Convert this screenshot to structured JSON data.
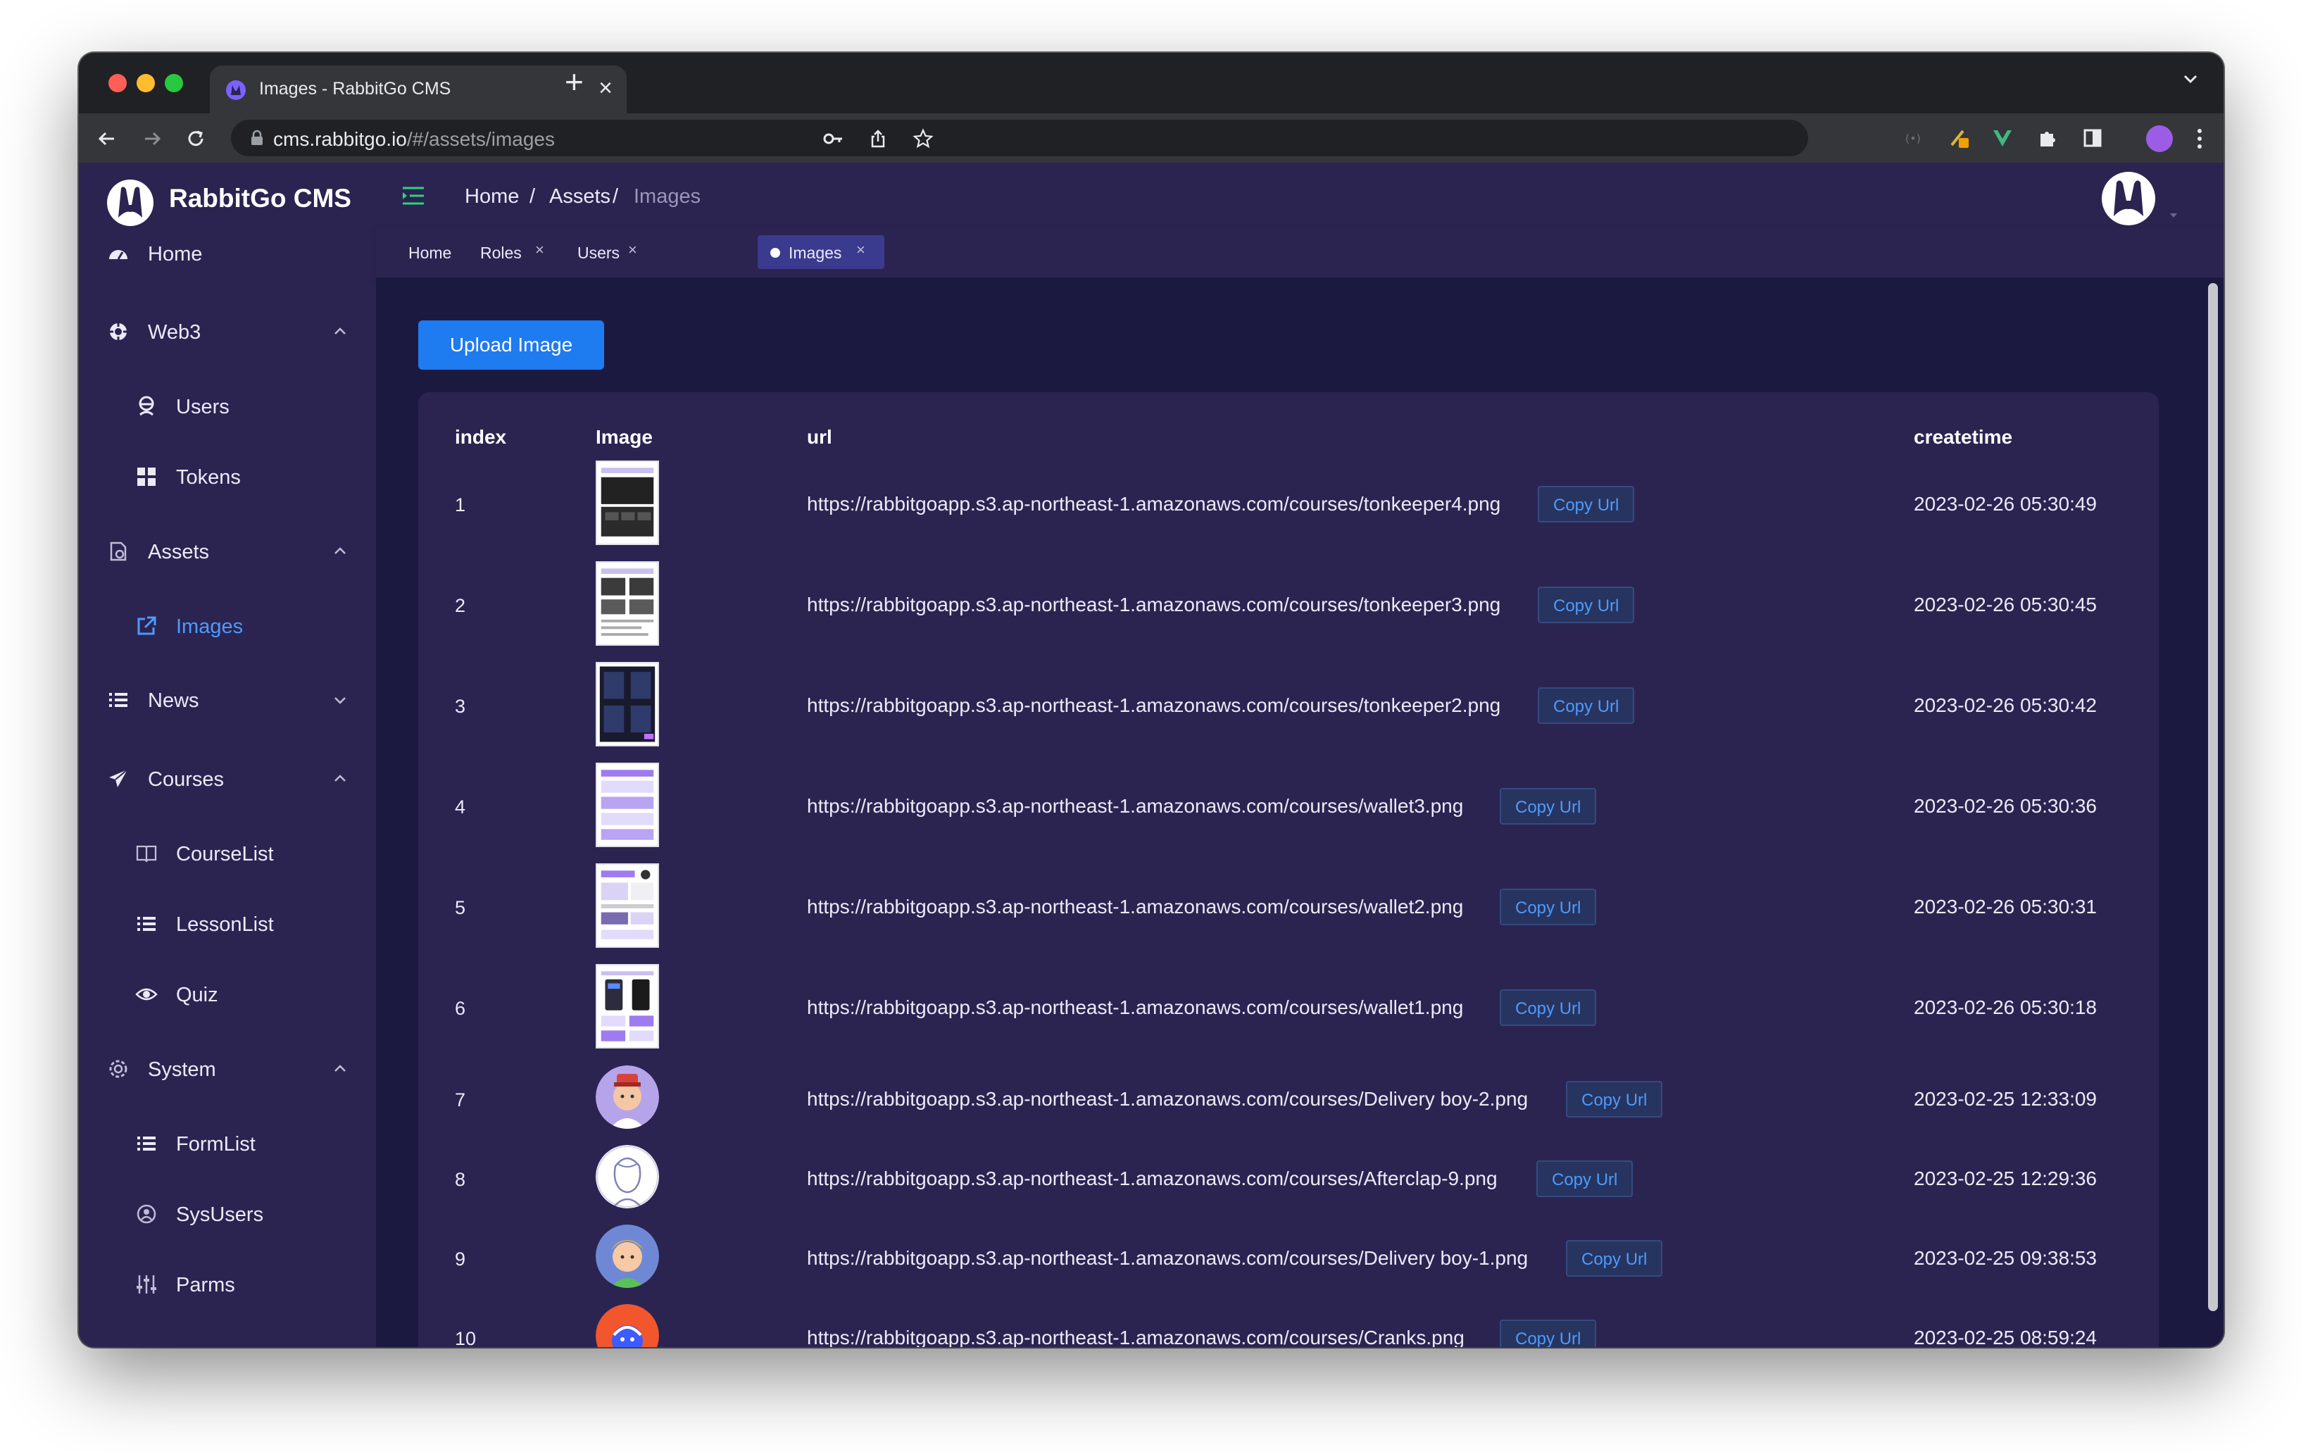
{
  "browser": {
    "tab_title": "Images - RabbitGo CMS",
    "url_host": "cms.rabbitgo.io",
    "url_path": "/#/assets/images"
  },
  "brand": {
    "name": "RabbitGo CMS"
  },
  "sidebar": {
    "items": [
      {
        "label": "Home",
        "icon": "dashboard-icon"
      },
      {
        "label": "Web3",
        "icon": "web3-icon"
      },
      {
        "label": "Users",
        "icon": "users-icon"
      },
      {
        "label": "Tokens",
        "icon": "grid-icon"
      },
      {
        "label": "Assets",
        "icon": "assets-icon"
      },
      {
        "label": "Images",
        "icon": "external-link-icon"
      },
      {
        "label": "News",
        "icon": "list-icon"
      },
      {
        "label": "Courses",
        "icon": "paper-plane-icon"
      },
      {
        "label": "CourseList",
        "icon": "book-icon"
      },
      {
        "label": "LessonList",
        "icon": "list-icon"
      },
      {
        "label": "Quiz",
        "icon": "eye-icon"
      },
      {
        "label": "System",
        "icon": "gear-icon"
      },
      {
        "label": "FormList",
        "icon": "list-icon"
      },
      {
        "label": "SysUsers",
        "icon": "user-circle-icon"
      },
      {
        "label": "Parms",
        "icon": "sliders-icon"
      }
    ]
  },
  "breadcrumb": {
    "home": "Home",
    "sep1": "/",
    "assets": "Assets",
    "sep2": "/",
    "current": "Images"
  },
  "tags": [
    {
      "label": "Home"
    },
    {
      "label": "Roles",
      "close": "×"
    },
    {
      "label": "Users",
      "close": "×"
    },
    {
      "label": "Images",
      "close": "×"
    }
  ],
  "upload_label": "Upload Image",
  "table": {
    "columns": {
      "index": "index",
      "image": "Image",
      "url": "url",
      "createtime": "createtime"
    },
    "copy_label": "Copy Url",
    "rows": [
      {
        "index": "1",
        "url": "https://rabbitgoapp.s3.ap-northeast-1.amazonaws.com/courses/tonkeeper4.png",
        "createtime": "2023-02-26 05:30:49"
      },
      {
        "index": "2",
        "url": "https://rabbitgoapp.s3.ap-northeast-1.amazonaws.com/courses/tonkeeper3.png",
        "createtime": "2023-02-26 05:30:45"
      },
      {
        "index": "3",
        "url": "https://rabbitgoapp.s3.ap-northeast-1.amazonaws.com/courses/tonkeeper2.png",
        "createtime": "2023-02-26 05:30:42"
      },
      {
        "index": "4",
        "url": "https://rabbitgoapp.s3.ap-northeast-1.amazonaws.com/courses/wallet3.png",
        "createtime": "2023-02-26 05:30:36"
      },
      {
        "index": "5",
        "url": "https://rabbitgoapp.s3.ap-northeast-1.amazonaws.com/courses/wallet2.png",
        "createtime": "2023-02-26 05:30:31"
      },
      {
        "index": "6",
        "url": "https://rabbitgoapp.s3.ap-northeast-1.amazonaws.com/courses/wallet1.png",
        "createtime": "2023-02-26 05:30:18"
      },
      {
        "index": "7",
        "url": "https://rabbitgoapp.s3.ap-northeast-1.amazonaws.com/courses/Delivery boy-2.png",
        "createtime": "2023-02-25 12:33:09"
      },
      {
        "index": "8",
        "url": "https://rabbitgoapp.s3.ap-northeast-1.amazonaws.com/courses/Afterclap-9.png",
        "createtime": "2023-02-25 12:29:36"
      },
      {
        "index": "9",
        "url": "https://rabbitgoapp.s3.ap-northeast-1.amazonaws.com/courses/Delivery boy-1.png",
        "createtime": "2023-02-25 09:38:53"
      },
      {
        "index": "10",
        "url": "https://rabbitgoapp.s3.ap-northeast-1.amazonaws.com/courses/Cranks.png",
        "createtime": "2023-02-25 08:59:24"
      }
    ]
  },
  "colors": {
    "sidebar_bg": "#2b2451",
    "content_bg": "#1c1940",
    "accent": "#1f7bf0",
    "link": "#4c9bff"
  }
}
